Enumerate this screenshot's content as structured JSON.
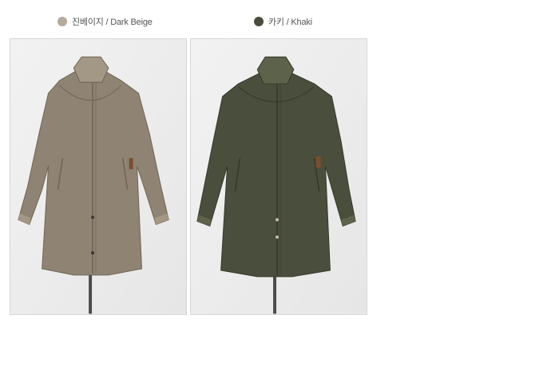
{
  "colors": [
    {
      "name": "진베이지 / Dark Beige",
      "swatch": "#b5aa9b",
      "coat": "#8f8373",
      "coat_dark": "#6f6456",
      "coat_light": "#a39785"
    },
    {
      "name": "카키 / Khaki",
      "swatch": "#4a4d3d",
      "coat": "#4a4e3c",
      "coat_dark": "#353829",
      "coat_light": "#5d624b"
    }
  ]
}
